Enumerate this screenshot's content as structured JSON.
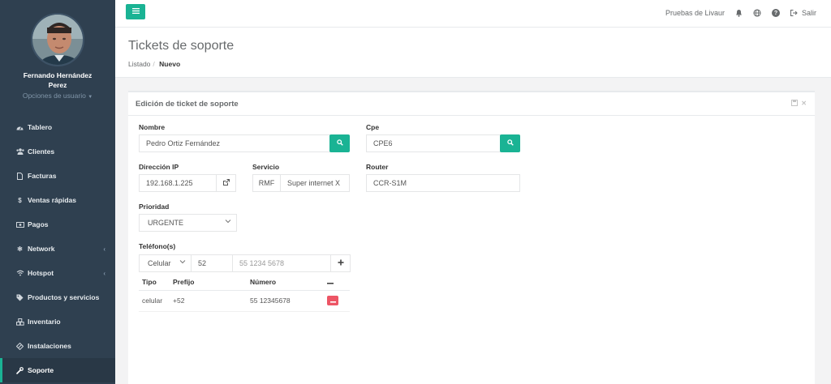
{
  "user": {
    "name": "Fernando Hernández Perez",
    "options": "Opciones de usuario"
  },
  "sidebar": {
    "items": [
      {
        "label": "Tablero",
        "icon": "dashboard-icon"
      },
      {
        "label": "Clientes",
        "icon": "users-icon"
      },
      {
        "label": "Facturas",
        "icon": "file-icon"
      },
      {
        "label": "Ventas rápidas",
        "icon": "dollar-icon"
      },
      {
        "label": "Pagos",
        "icon": "money-icon"
      },
      {
        "label": "Network",
        "icon": "network-icon"
      },
      {
        "label": "Hotspot",
        "icon": "wifi-icon"
      },
      {
        "label": "Productos y servicios",
        "icon": "tags-icon"
      },
      {
        "label": "Inventario",
        "icon": "cubes-icon"
      },
      {
        "label": "Instalaciones",
        "icon": "tools-icon"
      },
      {
        "label": "Soporte",
        "icon": "wrench-icon",
        "active": true
      }
    ]
  },
  "topbar": {
    "company": "Pruebas de Livaur",
    "logout": "Salir"
  },
  "page": {
    "title": "Tickets de soporte",
    "breadcrumb": [
      "Listado",
      "Nuevo"
    ]
  },
  "form": {
    "title": "Edición de ticket de soporte",
    "nombre_label": "Nombre",
    "nombre_value": "Pedro Ortiz Fernández",
    "cpe_label": "Cpe",
    "cpe_value": "CPE6",
    "ip_label": "Dirección IP",
    "ip_value": "192.168.1.225",
    "servicio_label": "Servicio",
    "servicio_prefix": "RMF",
    "servicio_value": "Super internet X",
    "router_label": "Router",
    "router_value": "CCR-S1M",
    "prioridad_label": "Prioridad",
    "prioridad_value": "URGENTE",
    "telefonos_label": "Teléfono(s)",
    "phone_type_value": "Celular",
    "phone_prefix_value": "52",
    "phone_number_placeholder": "55 1234 5678",
    "table": {
      "headers": [
        "Tipo",
        "Prefijo",
        "Número"
      ],
      "rows": [
        {
          "tipo": "celular",
          "prefijo": "+52",
          "numero": "55 12345678"
        }
      ]
    }
  },
  "colors": {
    "sidebar": "#2f4050",
    "accent": "#1ab394",
    "danger": "#ed5565"
  }
}
